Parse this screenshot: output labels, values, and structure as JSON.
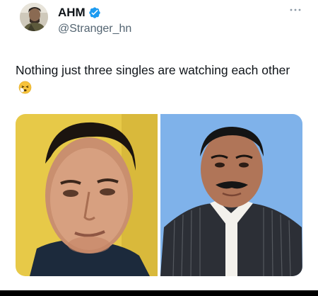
{
  "author": {
    "display_name": "AHM",
    "handle": "@Stranger_hn",
    "verified": true
  },
  "tweet": {
    "text": "Nothing just three singles are watching each other",
    "emoji": "sneezing-face-emoji"
  },
  "media": {
    "count": 2
  },
  "colors": {
    "verified_blue": "#1d9bf0",
    "text_primary": "#0f1419",
    "text_secondary": "#536471",
    "photo1_background": "#e7c948",
    "photo2_background": "#7fb2ea"
  }
}
